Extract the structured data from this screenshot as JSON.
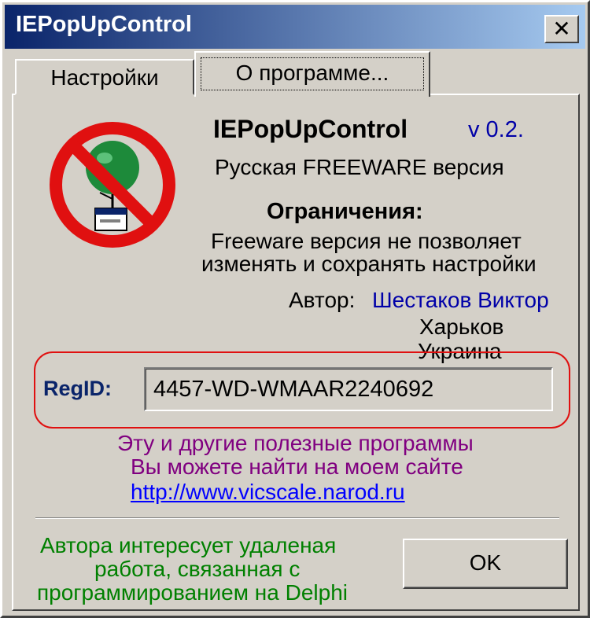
{
  "window": {
    "title": "IEPopUpControl",
    "close_glyph": "✕"
  },
  "tabs": [
    {
      "label": "Настройки"
    },
    {
      "label": "О программе..."
    }
  ],
  "about": {
    "app_name": "IEPopUpControl",
    "version": "v 0.2.",
    "edition": "Русская FREEWARE версия",
    "limitations_heading": "Ограничения:",
    "limitations_line1": "Freeware версия не позволяет",
    "limitations_line2": "изменять и сохранять настройки",
    "author_label": "Автор:",
    "author_name": "Шестаков Виктор",
    "city": "Харьков",
    "country": "Украина",
    "regid_label": "RegID:",
    "regid_value": "4457-WD-WMAAR2240692",
    "site_line1": "Эту и другие полезные программы",
    "site_line2": "Вы можете найти на моем сайте",
    "site_url": "http://www.vicscale.narod.ru",
    "hire_line1": "Автора интересует удаленая",
    "hire_line2": "работа, связанная с",
    "hire_line3": "программированием на Delphi",
    "ok_label": "OK"
  },
  "icons": {
    "logo": "no-popup-prohibited-icon"
  },
  "colors": {
    "titlebar_start": "#0a246a",
    "titlebar_end": "#a6caf0",
    "link": "#0000ff",
    "author": "#0000a8",
    "site_text": "#800080",
    "hire_text": "#008000",
    "highlight": "#e01010"
  }
}
